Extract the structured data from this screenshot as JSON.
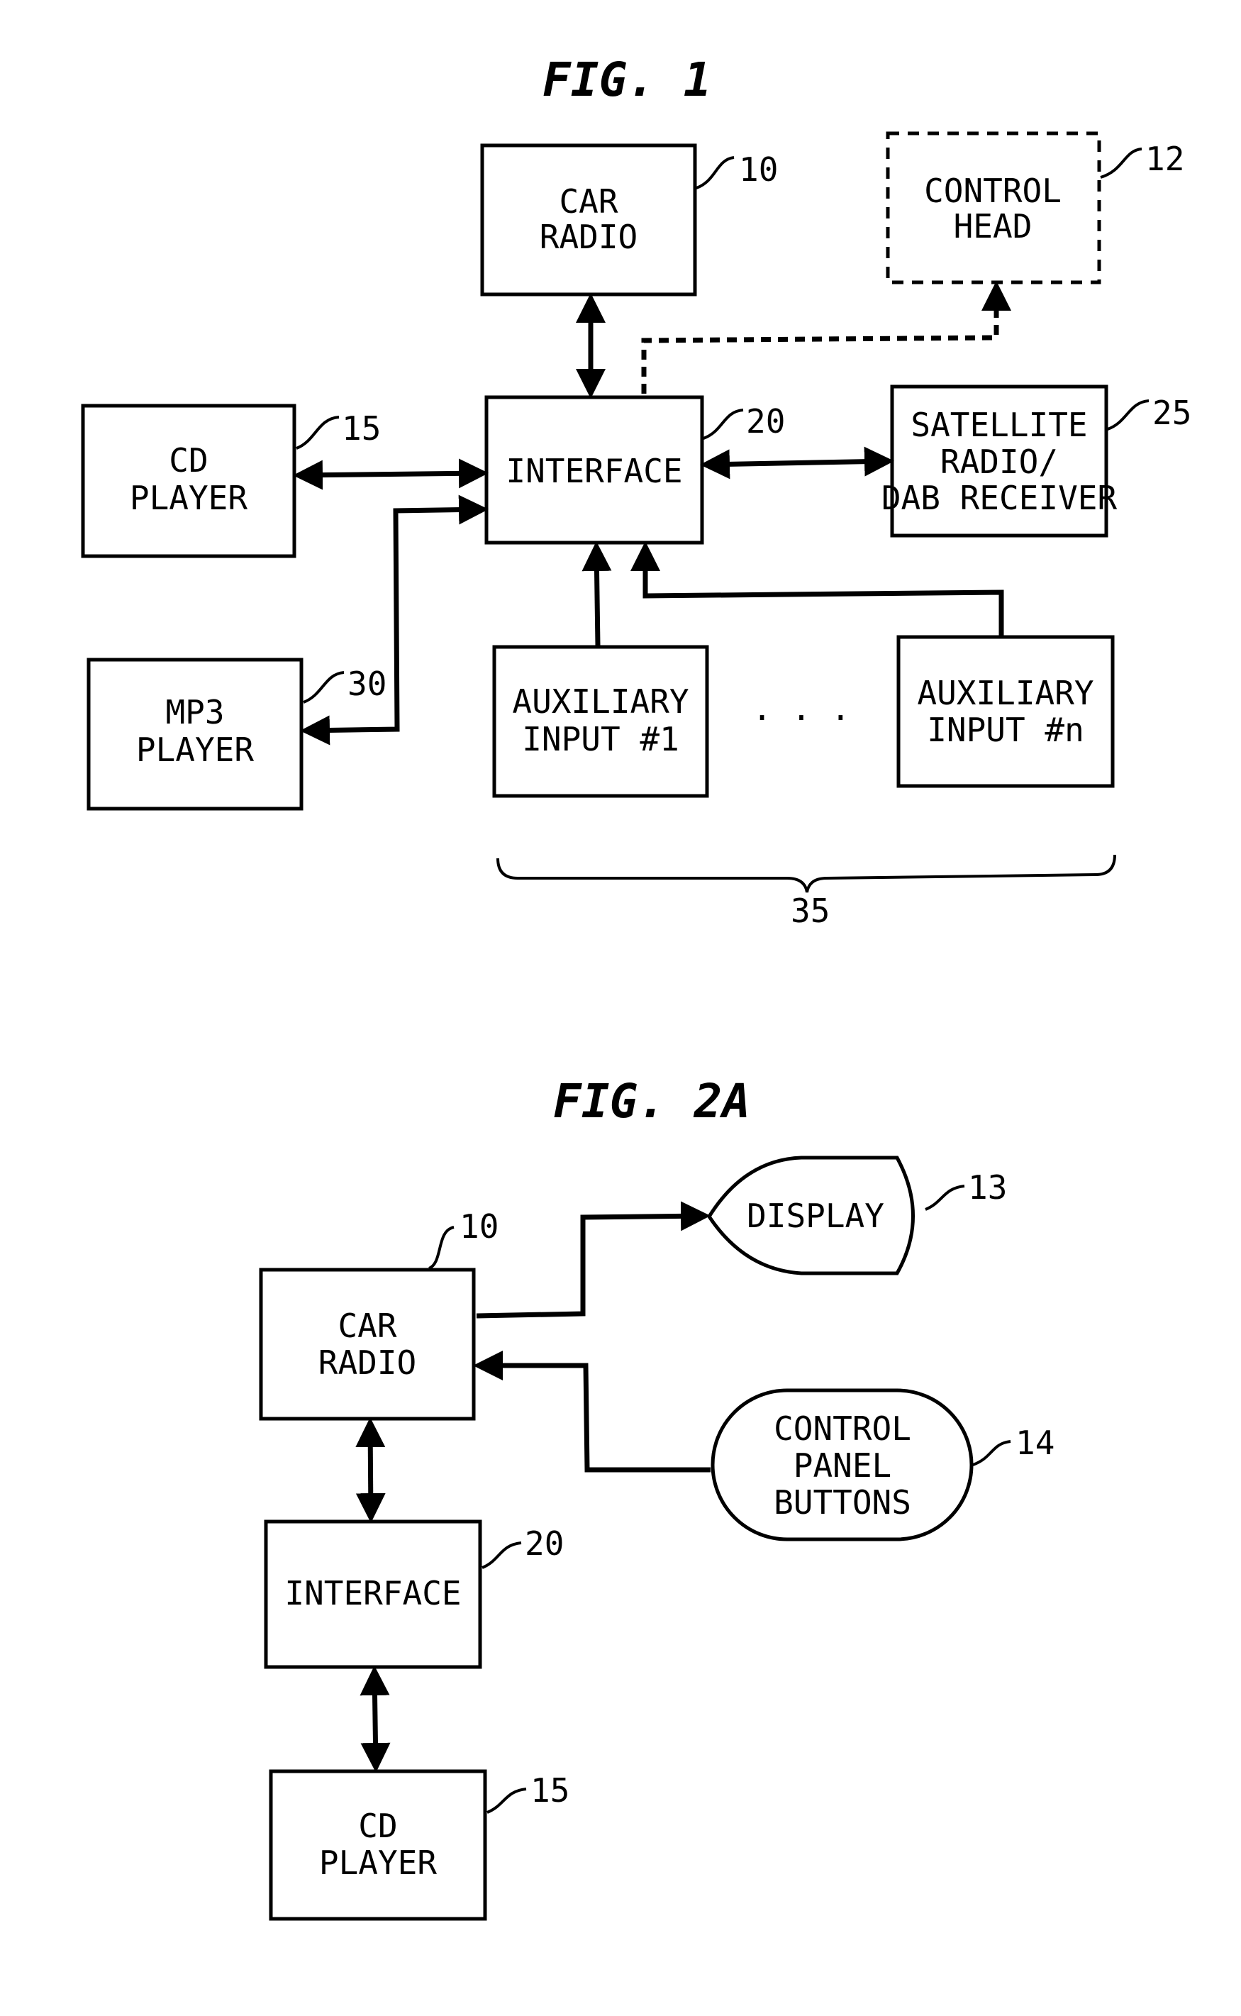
{
  "fig1": {
    "title": "FIG. 1",
    "car_radio": {
      "line1": "CAR",
      "line2": "RADIO",
      "ref": "10"
    },
    "control_head": {
      "line1": "CONTROL",
      "line2": "HEAD",
      "ref": "12"
    },
    "cd_player": {
      "line1": "CD",
      "line2": "PLAYER",
      "ref": "15"
    },
    "interface": {
      "line1": "INTERFACE",
      "ref": "20"
    },
    "satellite": {
      "line1": "SATELLITE",
      "line2": "RADIO/",
      "line3": "DAB RECEIVER",
      "ref": "25"
    },
    "mp3_player": {
      "line1": "MP3",
      "line2": "PLAYER",
      "ref": "30"
    },
    "aux1": {
      "line1": "AUXILIARY",
      "line2": "INPUT #1"
    },
    "auxn": {
      "line1": "AUXILIARY",
      "line2": "INPUT #n"
    },
    "ellipsis": ". . .",
    "aux_group_ref": "35"
  },
  "fig2a": {
    "title": "FIG. 2A",
    "car_radio": {
      "line1": "CAR",
      "line2": "RADIO",
      "ref": "10"
    },
    "display": {
      "line1": "DISPLAY",
      "ref": "13"
    },
    "control_panel": {
      "line1": "CONTROL",
      "line2": "PANEL",
      "line3": "BUTTONS",
      "ref": "14"
    },
    "interface": {
      "line1": "INTERFACE",
      "ref": "20"
    },
    "cd_player": {
      "line1": "CD",
      "line2": "PLAYER",
      "ref": "15"
    }
  }
}
